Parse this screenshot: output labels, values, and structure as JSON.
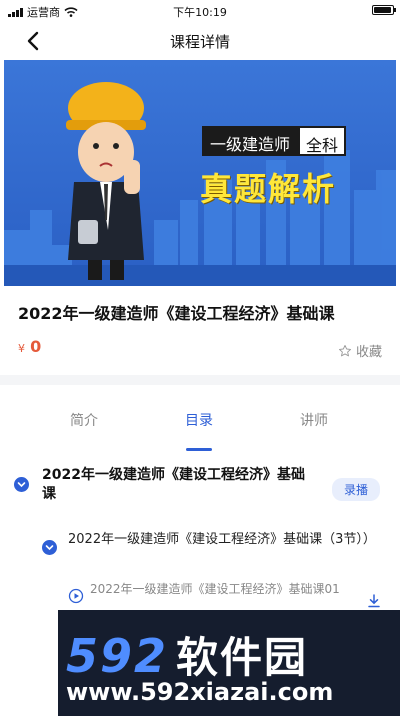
{
  "status_bar": {
    "carrier": "运营商",
    "time": "下午10:19"
  },
  "nav": {
    "title": "课程详情"
  },
  "banner": {
    "tag_left": "一级建造师",
    "tag_right": "全科",
    "headline": "真题解析"
  },
  "course": {
    "title": "2022年一级建造师《建设工程经济》基础课",
    "currency": "¥",
    "price": "0",
    "favorite_label": "收藏"
  },
  "tabs": [
    {
      "label": "简介"
    },
    {
      "label": "目录"
    },
    {
      "label": "讲师"
    }
  ],
  "active_tab": "目录",
  "catalog": {
    "chapter": {
      "title": "2022年一级建造师《建设工程经济》基础课",
      "badge": "录播"
    },
    "section": {
      "title": "2022年一级建造师《建设工程经济》基础课（3节））"
    },
    "lesson": {
      "title": "2022年一级建造师《建设工程经济》基础课01"
    }
  },
  "watermark": {
    "brand_num": "592",
    "brand_text": "软件园",
    "url": "www.592xiazai.com"
  },
  "colors": {
    "accent": "#2e5fd6",
    "price": "#e55a3b",
    "banner_bg": "#2d68cf",
    "headline": "#ffe73a"
  }
}
